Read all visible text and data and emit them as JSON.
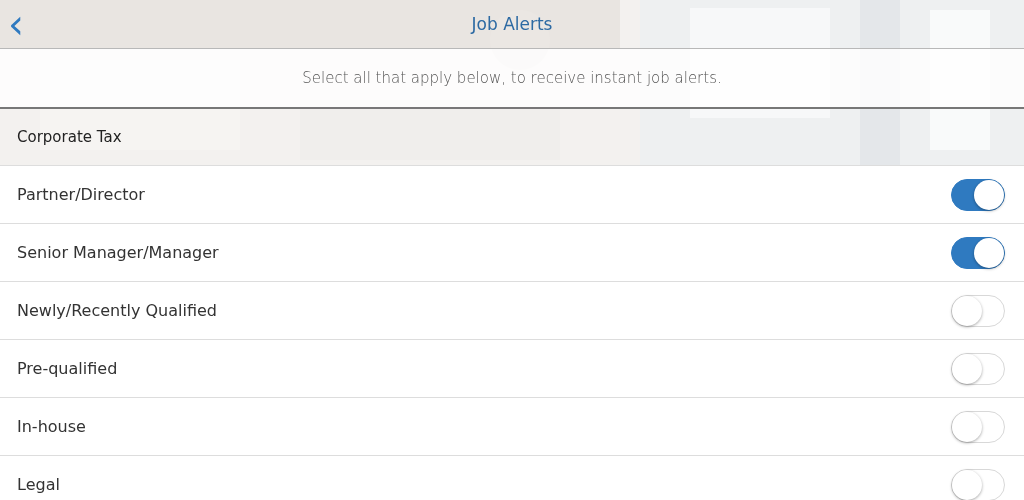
{
  "header": {
    "back_icon": "‹",
    "title": "Job Alerts"
  },
  "instructions": "Select all that apply below, to receive instant job alerts.",
  "section": {
    "title": "Corporate Tax"
  },
  "options": [
    {
      "label": "Partner/Director",
      "on": true
    },
    {
      "label": "Senior Manager/Manager",
      "on": true
    },
    {
      "label": "Newly/Recently Qualified",
      "on": false
    },
    {
      "label": "Pre-qualified",
      "on": false
    },
    {
      "label": "In-house",
      "on": false
    },
    {
      "label": "Legal",
      "on": false
    }
  ]
}
